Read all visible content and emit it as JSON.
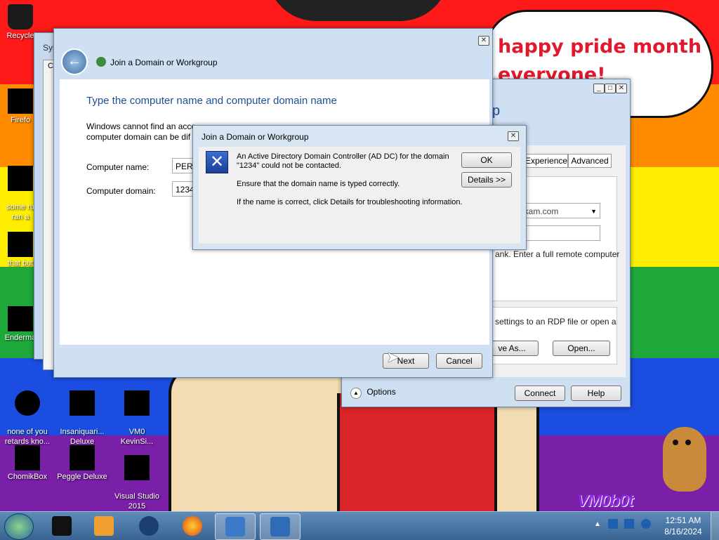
{
  "wallpaper": {
    "stripe_colors": [
      "#ff1a1a",
      "#ff8c00",
      "#ffee00",
      "#1fa83a",
      "#1a4de0",
      "#7a1fa8"
    ],
    "bubble_text": [
      "happy pride month",
      "everyone!"
    ],
    "watermark": "VM0b0t"
  },
  "desktop_icons": [
    {
      "name": "recycle-bin-icon",
      "label": "Recycle"
    },
    {
      "name": "firefox-desktop-icon",
      "label": "Firefo"
    },
    {
      "name": "some-file-icon",
      "label": "some ru\nran a"
    },
    {
      "name": "that-file-icon",
      "label": "that but"
    },
    {
      "name": "enderman-icon",
      "label": "Enderma"
    },
    {
      "name": "none-of-you-icon",
      "label": "none of you\nretards kno..."
    },
    {
      "name": "insaniquarium-icon",
      "label": "Insaniquari...\nDeluxe"
    },
    {
      "name": "vm0-kevin-icon",
      "label": "VM0\nKevinSi..."
    },
    {
      "name": "chomikbox-icon",
      "label": "ChomikBox"
    },
    {
      "name": "peggle-icon",
      "label": "Peggle Deluxe"
    },
    {
      "name": "visual-studio-icon",
      "label": "Visual Studio\n2015"
    }
  ],
  "system_window": {
    "title_fragment": "Sys",
    "tab_fragment": "C"
  },
  "rdp_window": {
    "title_fragment": "p",
    "tabs": [
      "Experience",
      "Advanced"
    ],
    "computer_value": "ikam.com",
    "hint_text": "ank. Enter a full remote computer",
    "settings_text": "settings to an RDP file or open a",
    "save_as_label": "ve As...",
    "open_label": "Open...",
    "options_label": "Options",
    "connect_label": "Connect",
    "help_label": "Help"
  },
  "wizard": {
    "title": "Join a Domain or Workgroup",
    "heading": "Type the computer name and computer domain name",
    "description_line1": "Windows cannot find an acco",
    "description_line1_tail": "f",
    "description_line2": "computer domain can be dif",
    "computer_name_label": "Computer name:",
    "computer_name_value": "PERI",
    "computer_domain_label": "Computer domain:",
    "computer_domain_value": "1234",
    "next_label": "Next",
    "cancel_label": "Cancel"
  },
  "error_dialog": {
    "title": "Join a Domain or Workgroup",
    "message_line1": "An Active Directory Domain Controller (AD DC) for the domain",
    "message_line2": "\"1234\" could not be contacted.",
    "message_line3": "Ensure that the domain name is typed correctly.",
    "message_line4": "If the name is correct, click Details for troubleshooting information.",
    "ok_label": "OK",
    "details_label": "Details >>"
  },
  "taskbar": {
    "time": "12:51 AM",
    "date": "8/16/2024"
  }
}
